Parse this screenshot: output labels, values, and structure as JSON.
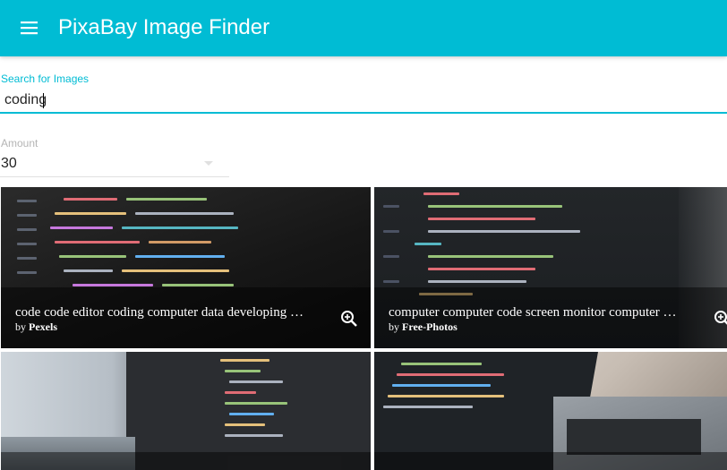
{
  "app": {
    "title": "PixaBay Image Finder"
  },
  "search": {
    "label": "Search for Images",
    "value": "coding"
  },
  "amount": {
    "label": "Amount",
    "value": "30"
  },
  "images": [
    {
      "tags": "code code editor coding computer data developing …",
      "by": "by",
      "user": "Pexels"
    },
    {
      "tags": "computer computer code screen monitor computer …",
      "by": "by",
      "user": "Free-Photos"
    }
  ],
  "colors": {
    "accent": "#00bcd4",
    "appbar_text": "#ffffff"
  },
  "icons": {
    "menu": "menu-icon",
    "zoom": "zoom-in-icon",
    "dropdown": "arrow-drop-down-icon"
  }
}
